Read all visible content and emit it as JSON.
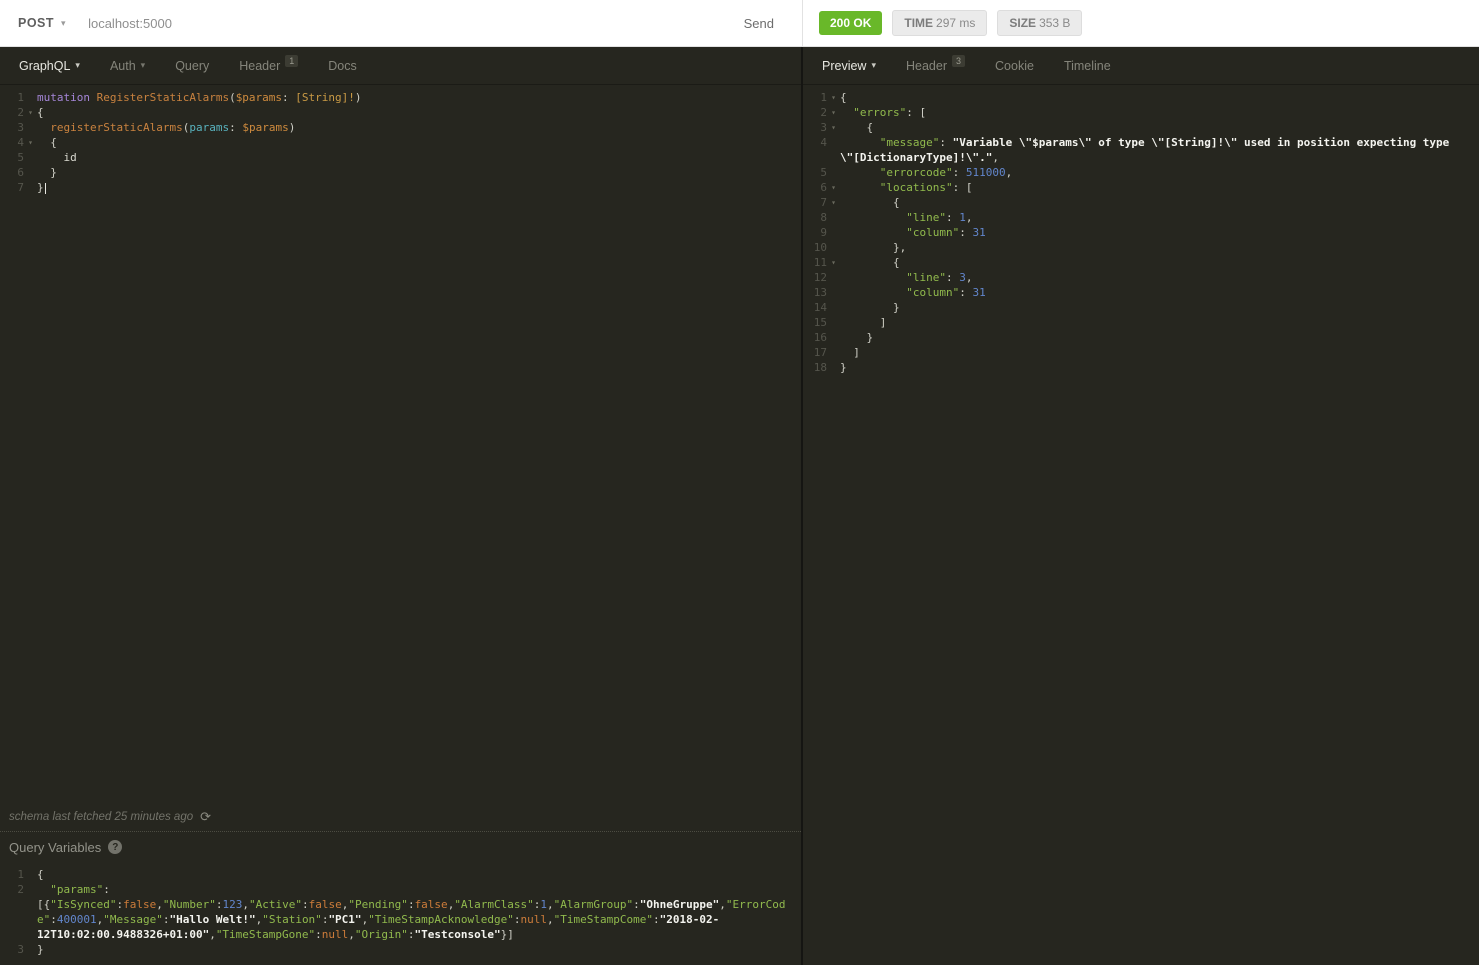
{
  "request_bar": {
    "method": "POST",
    "url": "localhost:5000",
    "send_label": "Send"
  },
  "response_bar": {
    "status": "200 OK",
    "time_label": "TIME",
    "time_value": "297 ms",
    "size_label": "SIZE",
    "size_value": "353 B"
  },
  "icons": {
    "chevron_down": "▾",
    "refresh": "⟳",
    "help": "?"
  },
  "request_tabs": [
    {
      "label": "GraphQL",
      "caret": true,
      "active": true
    },
    {
      "label": "Auth",
      "caret": true,
      "active": false
    },
    {
      "label": "Query",
      "active": false
    },
    {
      "label": "Header",
      "badge": "1",
      "active": false
    },
    {
      "label": "Docs",
      "active": false
    }
  ],
  "response_tabs": [
    {
      "label": "Preview",
      "caret": true,
      "active": true
    },
    {
      "label": "Header",
      "badge": "3",
      "active": false
    },
    {
      "label": "Cookie",
      "active": false
    },
    {
      "label": "Timeline",
      "active": false
    }
  ],
  "schema_note": "schema last fetched 25 minutes ago",
  "query_variables": {
    "title": "Query Variables"
  },
  "editors": {
    "graphql": {
      "lines": [
        {
          "n": "1",
          "tokens": [
            [
              "kw",
              "mutation"
            ],
            [
              "txt",
              " "
            ],
            [
              "def",
              "RegisterStaticAlarms"
            ],
            [
              "p",
              "("
            ],
            [
              "var",
              "$params"
            ],
            [
              "p",
              ":"
            ],
            [
              "txt",
              " "
            ],
            [
              "ty",
              "[String]!"
            ],
            [
              "p",
              ")"
            ]
          ]
        },
        {
          "n": "2",
          "fold": true,
          "tokens": [
            [
              "p",
              "{"
            ]
          ]
        },
        {
          "n": "3",
          "tokens": [
            [
              "txt",
              "  "
            ],
            [
              "def",
              "registerStaticAlarms"
            ],
            [
              "p",
              "("
            ],
            [
              "attr",
              "params"
            ],
            [
              "p",
              ":"
            ],
            [
              "txt",
              " "
            ],
            [
              "var",
              "$params"
            ],
            [
              "p",
              ")"
            ]
          ]
        },
        {
          "n": "4",
          "fold": true,
          "tokens": [
            [
              "txt",
              "  "
            ],
            [
              "p",
              "{"
            ]
          ]
        },
        {
          "n": "5",
          "tokens": [
            [
              "txt",
              "    "
            ],
            [
              "txt",
              "id"
            ]
          ]
        },
        {
          "n": "6",
          "tokens": [
            [
              "txt",
              "  "
            ],
            [
              "p",
              "}"
            ]
          ]
        },
        {
          "n": "7",
          "cursor": true,
          "tokens": [
            [
              "p",
              "}"
            ]
          ]
        }
      ]
    },
    "variables": {
      "lines": [
        {
          "n": "1",
          "tokens": [
            [
              "p",
              "{"
            ]
          ]
        },
        {
          "n": "2",
          "tokens": [
            [
              "txt",
              "  "
            ],
            [
              "key",
              "\"params\""
            ],
            [
              "p",
              ":"
            ],
            [
              "txt",
              " "
            ],
            [
              "p",
              "[{"
            ],
            [
              "key",
              "\"IsSynced\""
            ],
            [
              "p",
              ":"
            ],
            [
              "atom",
              "false"
            ],
            [
              "p",
              ","
            ],
            [
              "key",
              "\"Number\""
            ],
            [
              "p",
              ":"
            ],
            [
              "num",
              "123"
            ],
            [
              "p",
              ","
            ],
            [
              "key",
              "\"Active\""
            ],
            [
              "p",
              ":"
            ],
            [
              "atom",
              "false"
            ],
            [
              "p",
              ","
            ],
            [
              "key",
              "\"Pending\""
            ],
            [
              "p",
              ":"
            ],
            [
              "atom",
              "false"
            ],
            [
              "p",
              ","
            ],
            [
              "key",
              "\"AlarmClass\""
            ],
            [
              "p",
              ":"
            ],
            [
              "num",
              "1"
            ],
            [
              "p",
              ","
            ],
            [
              "key",
              "\"AlarmGroup\""
            ],
            [
              "p",
              ":"
            ],
            [
              "str",
              "\"OhneGruppe\""
            ],
            [
              "p",
              ","
            ],
            [
              "key",
              "\"ErrorCode\""
            ],
            [
              "p",
              ":"
            ],
            [
              "num",
              "400001"
            ],
            [
              "p",
              ","
            ],
            [
              "key",
              "\"Message\""
            ],
            [
              "p",
              ":"
            ],
            [
              "str",
              "\"Hallo Welt!\""
            ],
            [
              "p",
              ","
            ],
            [
              "key",
              "\"Station\""
            ],
            [
              "p",
              ":"
            ],
            [
              "str",
              "\"PC1\""
            ],
            [
              "p",
              ","
            ],
            [
              "key",
              "\"TimeStampAcknowledge\""
            ],
            [
              "p",
              ":"
            ],
            [
              "atom",
              "null"
            ],
            [
              "p",
              ","
            ],
            [
              "key",
              "\"TimeStampCome\""
            ],
            [
              "p",
              ":"
            ],
            [
              "str",
              "\"2018-02-12T10:02:00.9488326+01:00\""
            ],
            [
              "p",
              ","
            ],
            [
              "key",
              "\"TimeStampGone\""
            ],
            [
              "p",
              ":"
            ],
            [
              "atom",
              "null"
            ],
            [
              "p",
              ","
            ],
            [
              "key",
              "\"Origin\""
            ],
            [
              "p",
              ":"
            ],
            [
              "str",
              "\"Testconsole\""
            ],
            [
              "p",
              "}]"
            ]
          ]
        },
        {
          "n": "3",
          "tokens": [
            [
              "p",
              "}"
            ]
          ]
        }
      ]
    },
    "response": {
      "lines": [
        {
          "n": "1",
          "fold": true,
          "tokens": [
            [
              "p",
              "{"
            ]
          ]
        },
        {
          "n": "2",
          "fold": true,
          "tokens": [
            [
              "txt",
              "  "
            ],
            [
              "key",
              "\"errors\""
            ],
            [
              "p",
              ":"
            ],
            [
              "txt",
              " "
            ],
            [
              "p",
              "["
            ]
          ]
        },
        {
          "n": "3",
          "fold": true,
          "tokens": [
            [
              "txt",
              "    "
            ],
            [
              "p",
              "{"
            ]
          ]
        },
        {
          "n": "4",
          "tokens": [
            [
              "txt",
              "      "
            ],
            [
              "key",
              "\"message\""
            ],
            [
              "p",
              ":"
            ],
            [
              "txt",
              " "
            ],
            [
              "str",
              "\"Variable \\\"$params\\\" of type \\\"[String]!\\\" used in position expecting type \\\"[DictionaryType]!\\\".\""
            ],
            [
              "p",
              ","
            ]
          ]
        },
        {
          "n": "5",
          "tokens": [
            [
              "txt",
              "      "
            ],
            [
              "key",
              "\"errorcode\""
            ],
            [
              "p",
              ":"
            ],
            [
              "txt",
              " "
            ],
            [
              "num",
              "511000"
            ],
            [
              "p",
              ","
            ]
          ]
        },
        {
          "n": "6",
          "fold": true,
          "tokens": [
            [
              "txt",
              "      "
            ],
            [
              "key",
              "\"locations\""
            ],
            [
              "p",
              ":"
            ],
            [
              "txt",
              " "
            ],
            [
              "p",
              "["
            ]
          ]
        },
        {
          "n": "7",
          "fold": true,
          "tokens": [
            [
              "txt",
              "        "
            ],
            [
              "p",
              "{"
            ]
          ]
        },
        {
          "n": "8",
          "tokens": [
            [
              "txt",
              "          "
            ],
            [
              "key",
              "\"line\""
            ],
            [
              "p",
              ":"
            ],
            [
              "txt",
              " "
            ],
            [
              "num",
              "1"
            ],
            [
              "p",
              ","
            ]
          ]
        },
        {
          "n": "9",
          "tokens": [
            [
              "txt",
              "          "
            ],
            [
              "key",
              "\"column\""
            ],
            [
              "p",
              ":"
            ],
            [
              "txt",
              " "
            ],
            [
              "num",
              "31"
            ]
          ]
        },
        {
          "n": "10",
          "tokens": [
            [
              "txt",
              "        "
            ],
            [
              "p",
              "},"
            ]
          ]
        },
        {
          "n": "11",
          "fold": true,
          "tokens": [
            [
              "txt",
              "        "
            ],
            [
              "p",
              "{"
            ]
          ]
        },
        {
          "n": "12",
          "tokens": [
            [
              "txt",
              "          "
            ],
            [
              "key",
              "\"line\""
            ],
            [
              "p",
              ":"
            ],
            [
              "txt",
              " "
            ],
            [
              "num",
              "3"
            ],
            [
              "p",
              ","
            ]
          ]
        },
        {
          "n": "13",
          "tokens": [
            [
              "txt",
              "          "
            ],
            [
              "key",
              "\"column\""
            ],
            [
              "p",
              ":"
            ],
            [
              "txt",
              " "
            ],
            [
              "num",
              "31"
            ]
          ]
        },
        {
          "n": "14",
          "tokens": [
            [
              "txt",
              "        "
            ],
            [
              "p",
              "}"
            ]
          ]
        },
        {
          "n": "15",
          "tokens": [
            [
              "txt",
              "      "
            ],
            [
              "p",
              "]"
            ]
          ]
        },
        {
          "n": "16",
          "tokens": [
            [
              "txt",
              "    "
            ],
            [
              "p",
              "}"
            ]
          ]
        },
        {
          "n": "17",
          "tokens": [
            [
              "txt",
              "  "
            ],
            [
              "p",
              "]"
            ]
          ]
        },
        {
          "n": "18",
          "tokens": [
            [
              "p",
              "}"
            ]
          ]
        }
      ]
    }
  }
}
